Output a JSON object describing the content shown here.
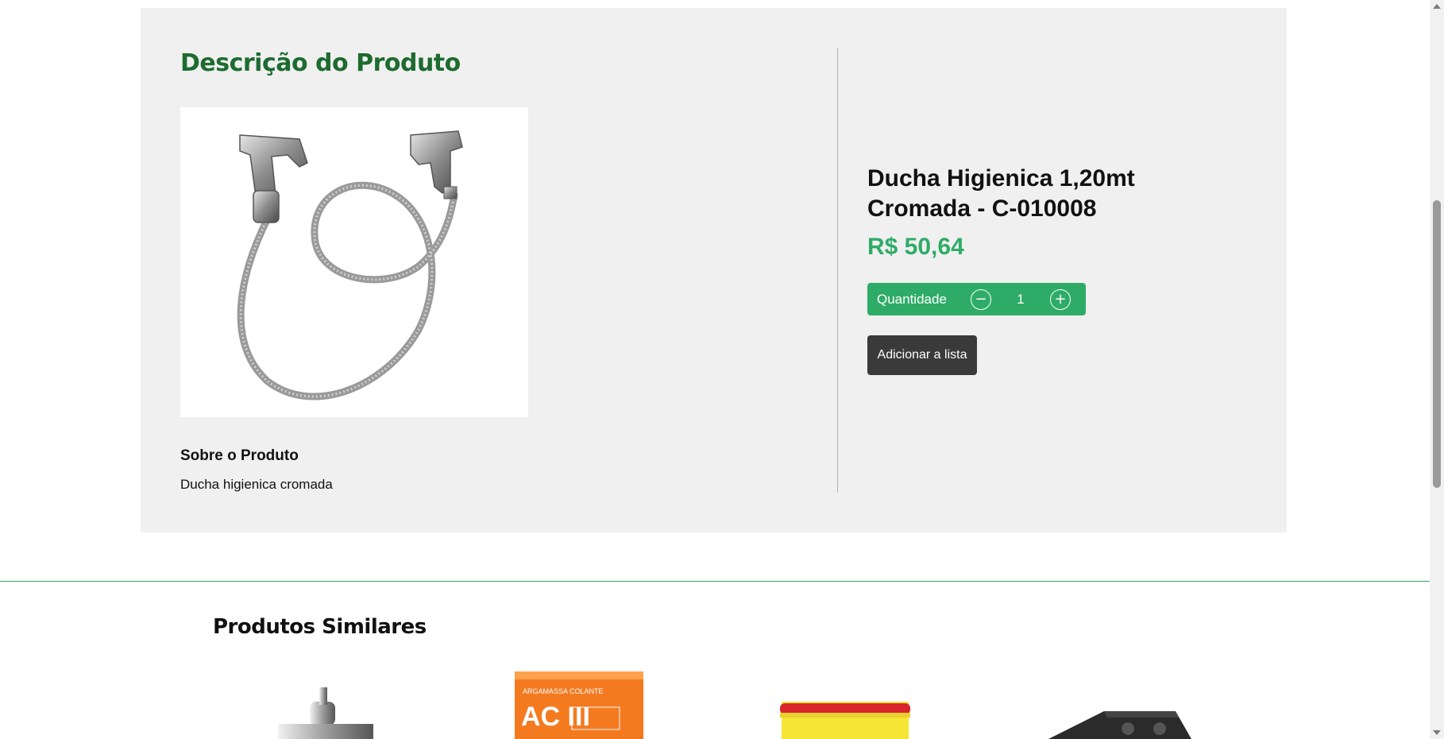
{
  "description_section": {
    "title": "Descrição do Produto",
    "about_title": "Sobre o Produto",
    "about_text": "Ducha higienica cromada",
    "product_image_icon": "hygienic-shower-image"
  },
  "product": {
    "name": "Ducha Higienica 1,20mt Cromada - C-010008",
    "price": "R$ 50,64",
    "price_color": "#2eac67"
  },
  "quantity": {
    "label": "Quantidade",
    "minus_icon": "minus-circle-icon",
    "plus_icon": "plus-circle-icon",
    "value": "1"
  },
  "actions": {
    "add_to_list": "Adicionar a lista"
  },
  "similar": {
    "title": "Produtos Similares",
    "items": [
      {
        "icon": "faucet-image"
      },
      {
        "icon": "mortar-bag-image",
        "brand_text": "ARGAMASSA COLANTE",
        "big_text": "AC III"
      },
      {
        "icon": "paint-bucket-image"
      },
      {
        "icon": "cooktop-image"
      }
    ]
  },
  "colors": {
    "title_green": "#1d6b2f",
    "accent_green": "#2eac67",
    "panel_bg": "#f0f0f0",
    "dark_button": "#3a3a3a"
  }
}
